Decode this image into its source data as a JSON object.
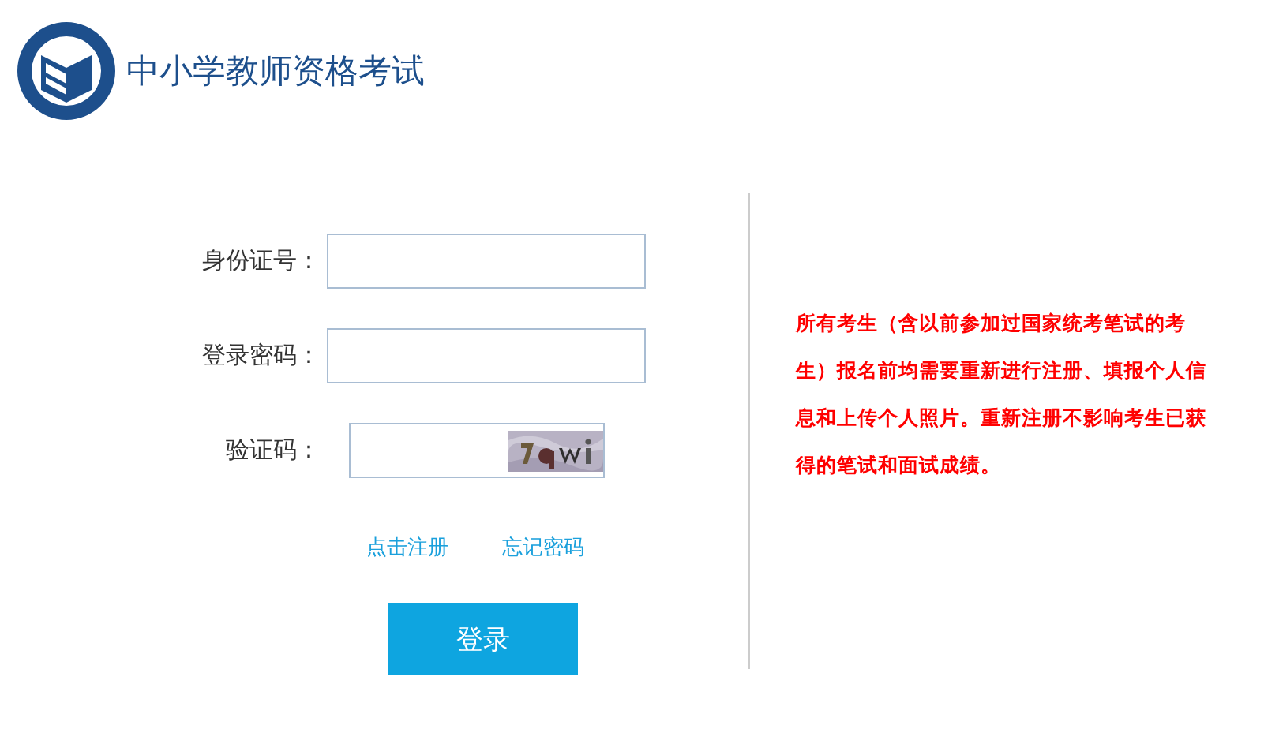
{
  "header": {
    "title": "中小学教师资格考试"
  },
  "form": {
    "fields": [
      {
        "label": "身份证号：",
        "kind": "text"
      },
      {
        "label": "登录密码：",
        "kind": "password"
      },
      {
        "label": "验证码：",
        "kind": "captcha"
      }
    ],
    "links": [
      "点击注册",
      "忘记密码"
    ],
    "submit": "登录"
  },
  "notice": "所有考生（含以前参加过国家统考笔试的考生）报名前均需要重新进行注册、填报个人信息和上传个人照片。重新注册不影响考生已获得的笔试和面试成绩。"
}
